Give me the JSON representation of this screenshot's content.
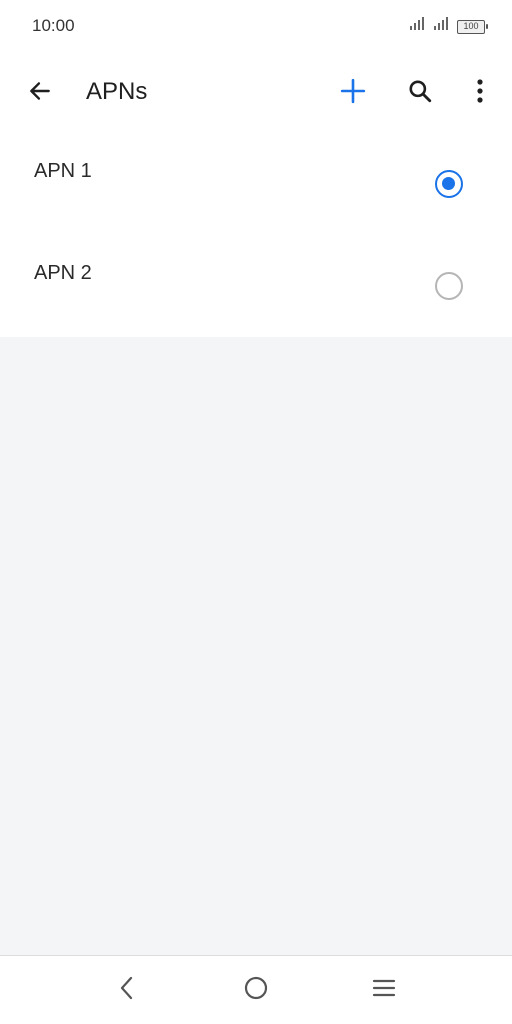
{
  "status_bar": {
    "time": "10:00",
    "battery_level": "100",
    "icons": [
      "signal-icon",
      "signal-icon",
      "battery-icon"
    ]
  },
  "app_bar": {
    "title": "APNs",
    "back_icon": "arrow-left-icon",
    "add_icon": "plus-icon",
    "search_icon": "search-icon",
    "more_icon": "more-vertical-icon",
    "accent_color": "#1a73e8"
  },
  "apns": [
    {
      "label": "APN 1",
      "selected": true
    },
    {
      "label": "APN 2",
      "selected": false
    }
  ],
  "nav_bar": {
    "icons": [
      "back-nav-icon",
      "home-nav-icon",
      "recents-nav-icon"
    ]
  }
}
